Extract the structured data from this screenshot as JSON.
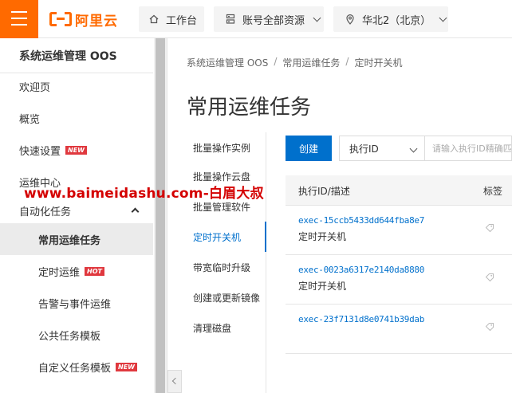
{
  "topbar": {
    "logo_text": "阿里云",
    "workbench": "工作台",
    "account_resources": "账号全部资源",
    "region": "华北2（北京）",
    "accent": "#ff6a00"
  },
  "sidebar": {
    "title": "系统运维管理 OOS",
    "items": [
      {
        "label": "欢迎页"
      },
      {
        "label": "概览"
      },
      {
        "label": "快速设置",
        "badge": "NEW"
      },
      {
        "label": "运维中心"
      },
      {
        "label": "自动化任务"
      },
      {
        "label": "常用运维任务"
      },
      {
        "label": "定时运维",
        "badge": "HOT"
      },
      {
        "label": "告警与事件运维"
      },
      {
        "label": "公共任务模板"
      },
      {
        "label": "自定义任务模板",
        "badge": "NEW"
      }
    ]
  },
  "main": {
    "breadcrumb": [
      "系统运维管理 OOS",
      "常用运维任务",
      "定时开关机"
    ],
    "title": "常用运维任务",
    "subnav": [
      "批量操作实例",
      "批量操作云盘",
      "批量管理软件",
      "定时开关机",
      "带宽临时升级",
      "创建或更新镜像",
      "清理磁盘"
    ],
    "create_label": "创建",
    "filter_select": "执行ID",
    "search_placeholder": "请输入执行ID精确匹配",
    "table": {
      "headers": [
        "执行ID/描述",
        "标签"
      ],
      "rows": [
        {
          "id": "exec-15ccb5433dd644fba8e7",
          "desc": "定时开关机"
        },
        {
          "id": "exec-0023a6317e2140da8880",
          "desc": "定时开关机"
        },
        {
          "id": "exec-23f7131d8e0741b39dab",
          "desc": ""
        }
      ]
    }
  },
  "watermark": "www.baimeidashu.com-白眉大叔",
  "colors": {
    "primary": "#0070cc",
    "badge": "#e0383e"
  }
}
